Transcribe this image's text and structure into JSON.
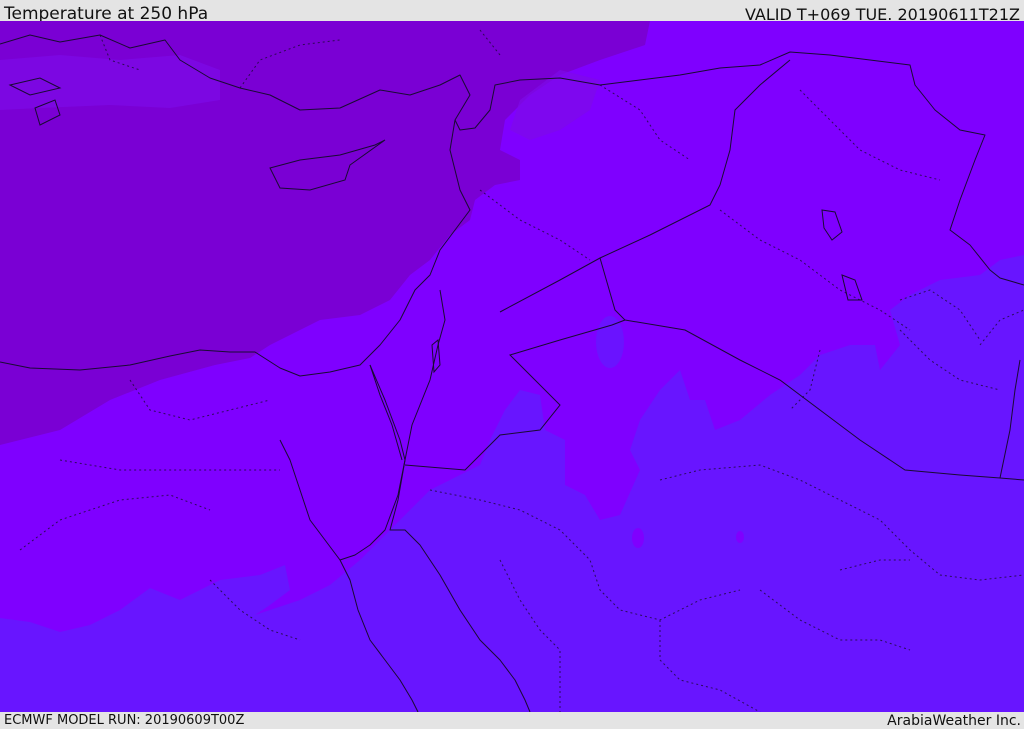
{
  "header": {
    "title": "Temperature at 250 hPa",
    "valid": "VALID T+069 TUE. 20190611T21Z"
  },
  "footer": {
    "model_run": "ECMWF MODEL RUN: 20190609T00Z",
    "credit": "ArabiaWeather Inc."
  },
  "colors": {
    "dark_violet": "#7a00d4",
    "violet": "#7f00ff",
    "blue_violet": "#6815ff",
    "boundary": "#1a0a33"
  }
}
